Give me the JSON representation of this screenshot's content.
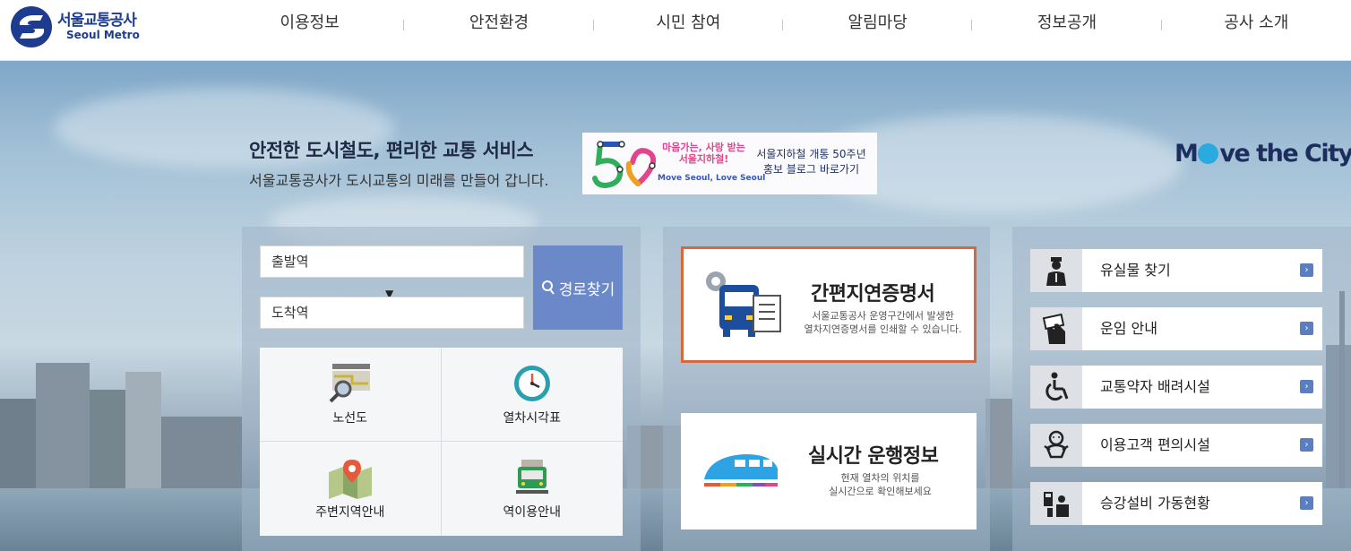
{
  "header": {
    "logo_ko": "서울교통공사",
    "logo_en": "Seoul Metro",
    "nav": [
      "이용정보",
      "안전환경",
      "시민 참여",
      "알림마당",
      "정보공개",
      "공사 소개"
    ]
  },
  "hero": {
    "title": "안전한 도시철도, 편리한 교통 서비스",
    "subtitle": "서울교통공사가 도시교통의 미래를 만들어 갑니다.",
    "brand_pre": "M",
    "brand_post": "ve the City",
    "banner": {
      "pink_line1": "마음가는, 사랑 받는",
      "pink_line2": "서울지하철!",
      "en": "Move Seoul, Love Seoul",
      "line1": "서울지하철 개통 50주년",
      "line2": "홍보 블로그 바로가기"
    }
  },
  "route": {
    "departure_placeholder": "출발역",
    "arrival_placeholder": "도착역",
    "search_label": "경로찾기"
  },
  "quick": [
    {
      "label": "노선도",
      "icon": "route-map-icon"
    },
    {
      "label": "열차시각표",
      "icon": "clock-icon"
    },
    {
      "label": "주변지역안내",
      "icon": "map-pin-icon"
    },
    {
      "label": "역이용안내",
      "icon": "train-front-icon"
    }
  ],
  "cards": {
    "delay": {
      "title": "간편지연증명서",
      "desc1": "서울교통공사 운영구간에서 발생한",
      "desc2": "열차지연증명서를 인쇄할 수 있습니다."
    },
    "live": {
      "title": "실시간 운행정보",
      "desc1": "현재 열차의 위치를",
      "desc2": "실시간으로 확인해보세요"
    }
  },
  "services": [
    {
      "label": "유실물 찾기",
      "icon": "staff-icon"
    },
    {
      "label": "운임 안내",
      "icon": "ticket-icon"
    },
    {
      "label": "교통약자 배려시설",
      "icon": "wheelchair-icon"
    },
    {
      "label": "이용고객 편의시설",
      "icon": "baby-icon"
    },
    {
      "label": "승강설비 가동현황",
      "icon": "elevator-icon"
    }
  ],
  "colors": {
    "brand_navy": "#1d3c8f",
    "route_button": "#6b88c9",
    "card_highlight": "#d3693f",
    "arrow_blue": "#5b7ec0"
  }
}
